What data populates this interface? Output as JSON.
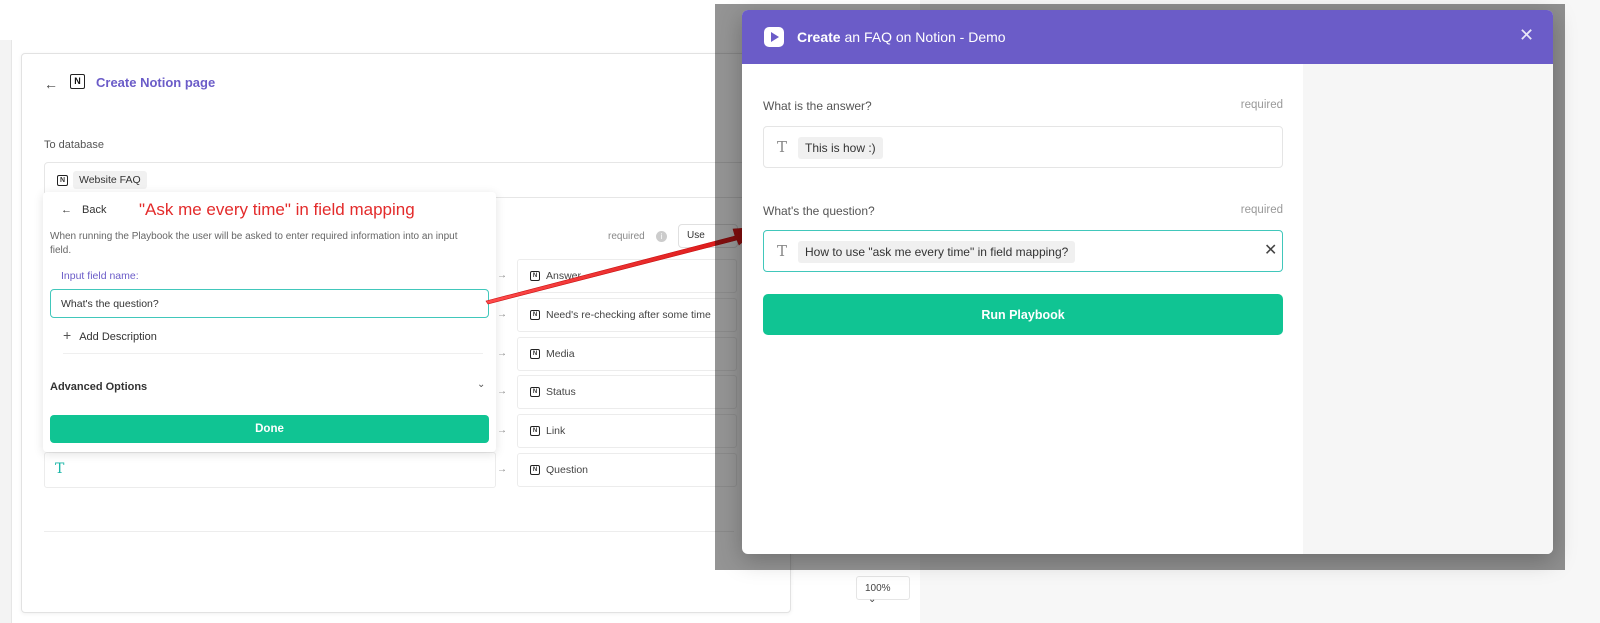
{
  "editor": {
    "title": "Create Notion page",
    "database_label": "To database",
    "database_name": "Website FAQ",
    "required_label": "required",
    "use_button_fragment": "Use",
    "fields": [
      {
        "label": "Answer"
      },
      {
        "label": "Need's re-checking after some time"
      },
      {
        "label": "Media"
      },
      {
        "label": "Status"
      },
      {
        "label": "Link"
      },
      {
        "label": "Question"
      }
    ]
  },
  "popover": {
    "back_label": "Back",
    "description": "When running the Playbook the user will be asked to enter required information into an input field.",
    "input_label": "Input field name:",
    "input_value": "What's the question?",
    "add_description_label": "Add Description",
    "advanced_label": "Advanced Options",
    "done_label": "Done"
  },
  "annotation": {
    "text": "\"Ask me every time\" in field mapping"
  },
  "zoom": {
    "value": "100%"
  },
  "modal": {
    "title_bold": "Create",
    "title_rest": " an FAQ on Notion - Demo",
    "fields": [
      {
        "label": "What is the answer?",
        "required": "required",
        "value": "This is how :)"
      },
      {
        "label": "What's the question?",
        "required": "required",
        "value": "How to use \"ask me every time\" in field mapping?"
      }
    ],
    "run_label": "Run Playbook"
  },
  "colors": {
    "brand_purple": "#6b5cc8",
    "primary_green": "#10c493",
    "focus_teal": "#41c7bb",
    "annotation_red": "#e32b2b"
  },
  "icons": [
    "back-arrow-icon",
    "notion-icon",
    "info-icon",
    "arrow-right-icon",
    "plus-icon",
    "chevron-down-icon",
    "text-type-icon",
    "play-icon",
    "close-icon",
    "clear-icon"
  ]
}
